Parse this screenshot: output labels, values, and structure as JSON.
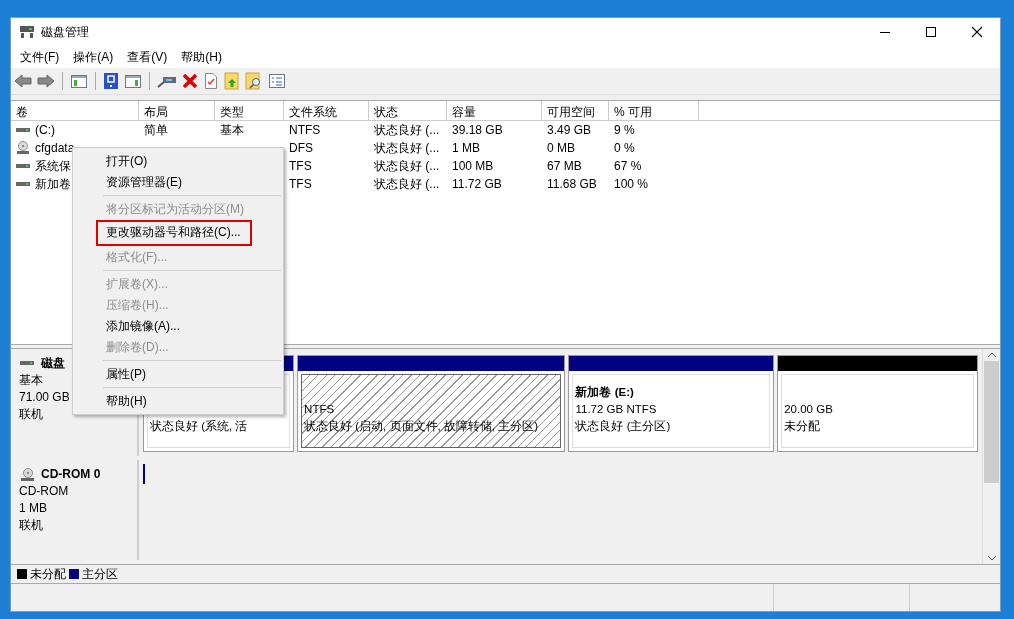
{
  "window": {
    "title": "磁盘管理"
  },
  "menu_bar": [
    "文件(F)",
    "操作(A)",
    "查看(V)",
    "帮助(H)"
  ],
  "volumes": {
    "columns": [
      "卷",
      "布局",
      "类型",
      "文件系统",
      "状态",
      "容量",
      "可用空间",
      "% 可用"
    ],
    "rows": [
      {
        "kind": "drive",
        "cells": [
          "(C:)",
          "简单",
          "基本",
          "NTFS",
          "状态良好 (...",
          "39.18 GB",
          "3.49 GB",
          "9 %"
        ]
      },
      {
        "kind": "cd",
        "cells": [
          "cfgdata",
          null,
          null,
          "DFS",
          "状态良好 (...",
          "1 MB",
          "0 MB",
          "0 %"
        ]
      },
      {
        "kind": "drive",
        "cells": [
          "系统保",
          null,
          null,
          "TFS",
          "状态良好 (...",
          "100 MB",
          "67 MB",
          "67 %"
        ]
      },
      {
        "kind": "drive",
        "cells": [
          "新加卷",
          null,
          null,
          "TFS",
          "状态良好 (...",
          "11.72 GB",
          "11.68 GB",
          "100 %"
        ]
      }
    ]
  },
  "disks": [
    {
      "kind": "disk",
      "name": "磁盘",
      "lines": [
        "基本",
        "71.00 GB",
        "联机"
      ],
      "partitions": [
        {
          "kind": "primary",
          "selected": false,
          "lines": [
            "状态良好 (系统, 活"
          ]
        },
        {
          "kind": "primary",
          "selected": true,
          "lines": [
            "NTFS",
            "状态良好 (启动, 页面文件, 故障转储, 主分区)"
          ]
        },
        {
          "kind": "primary",
          "selected": false,
          "title": "新加卷  (E:)",
          "lines": [
            "11.72 GB NTFS",
            "状态良好 (主分区)"
          ]
        },
        {
          "kind": "unallocated",
          "selected": false,
          "lines": [
            "20.00 GB",
            "未分配"
          ]
        }
      ]
    },
    {
      "kind": "cd",
      "name": "CD-ROM 0",
      "lines": [
        "CD-ROM",
        "1 MB",
        "联机"
      ]
    }
  ],
  "legend": [
    {
      "label": "未分配",
      "color": "#000000"
    },
    {
      "label": "主分区",
      "color": "#000080"
    }
  ],
  "context_menu": [
    {
      "kind": "item",
      "label": "打开(O)",
      "disabled": false,
      "marked": false
    },
    {
      "kind": "item",
      "label": "资源管理器(E)",
      "disabled": false,
      "marked": false
    },
    {
      "kind": "separator"
    },
    {
      "kind": "item",
      "label": "将分区标记为活动分区(M)",
      "disabled": true,
      "marked": false
    },
    {
      "kind": "item",
      "label": "更改驱动器号和路径(C)...",
      "disabled": false,
      "marked": true
    },
    {
      "kind": "item",
      "label": "格式化(F)...",
      "disabled": true,
      "marked": false
    },
    {
      "kind": "separator"
    },
    {
      "kind": "item",
      "label": "扩展卷(X)...",
      "disabled": true,
      "marked": false
    },
    {
      "kind": "item",
      "label": "压缩卷(H)...",
      "disabled": true,
      "marked": false
    },
    {
      "kind": "item",
      "label": "添加镜像(A)...",
      "disabled": false,
      "marked": false
    },
    {
      "kind": "item",
      "label": "删除卷(D)...",
      "disabled": true,
      "marked": false
    },
    {
      "kind": "separator"
    },
    {
      "kind": "item",
      "label": "属性(P)",
      "disabled": false,
      "marked": false
    },
    {
      "kind": "separator"
    },
    {
      "kind": "item",
      "label": "帮助(H)",
      "disabled": false,
      "marked": false
    }
  ]
}
